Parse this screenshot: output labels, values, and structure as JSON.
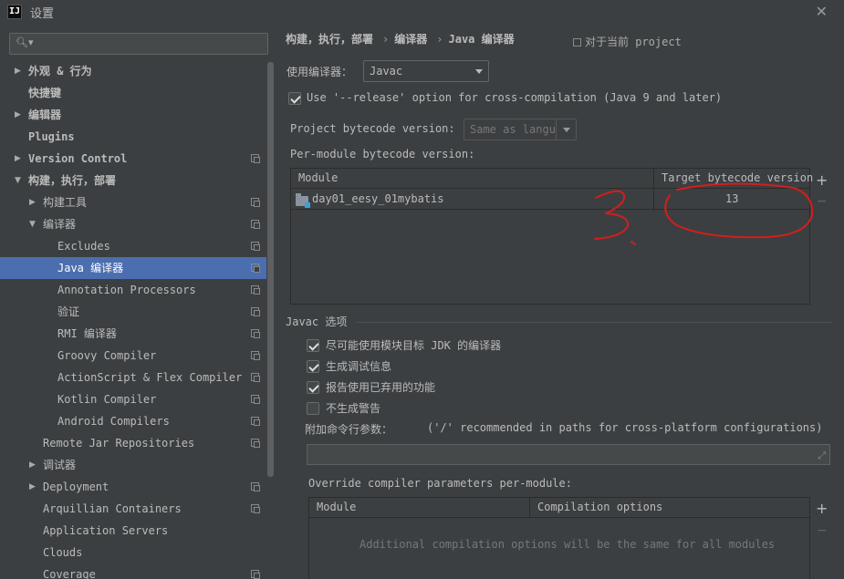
{
  "window": {
    "title": "设置",
    "app_icon": "intellij-icon",
    "close_icon": "close-icon"
  },
  "search": {
    "placeholder": "",
    "icon": "search-icon"
  },
  "tree": [
    {
      "label": "外观 & 行为",
      "level": 0,
      "arrow": "right",
      "copy": false,
      "selected": false,
      "bold": true
    },
    {
      "label": "快捷键",
      "level": 0,
      "arrow": "none",
      "copy": false,
      "selected": false,
      "bold": true
    },
    {
      "label": "编辑器",
      "level": 0,
      "arrow": "right",
      "copy": false,
      "selected": false,
      "bold": true
    },
    {
      "label": "Plugins",
      "level": 0,
      "arrow": "none",
      "copy": false,
      "selected": false,
      "bold": true
    },
    {
      "label": "Version Control",
      "level": 0,
      "arrow": "right",
      "copy": true,
      "selected": false,
      "bold": true
    },
    {
      "label": "构建，执行，部署",
      "level": 0,
      "arrow": "down",
      "copy": false,
      "selected": false,
      "bold": true
    },
    {
      "label": "构建工具",
      "level": 1,
      "arrow": "right",
      "copy": true,
      "selected": false,
      "bold": false
    },
    {
      "label": "编译器",
      "level": 1,
      "arrow": "down",
      "copy": true,
      "selected": false,
      "bold": false
    },
    {
      "label": "Excludes",
      "level": 2,
      "arrow": "none",
      "copy": true,
      "selected": false,
      "bold": false
    },
    {
      "label": "Java 编译器",
      "level": 2,
      "arrow": "none",
      "copy": true,
      "selected": true,
      "bold": false
    },
    {
      "label": "Annotation Processors",
      "level": 2,
      "arrow": "none",
      "copy": true,
      "selected": false,
      "bold": false
    },
    {
      "label": "验证",
      "level": 2,
      "arrow": "none",
      "copy": true,
      "selected": false,
      "bold": false
    },
    {
      "label": "RMI 编译器",
      "level": 2,
      "arrow": "none",
      "copy": true,
      "selected": false,
      "bold": false
    },
    {
      "label": "Groovy Compiler",
      "level": 2,
      "arrow": "none",
      "copy": true,
      "selected": false,
      "bold": false
    },
    {
      "label": "ActionScript & Flex Compiler",
      "level": 2,
      "arrow": "none",
      "copy": true,
      "selected": false,
      "bold": false
    },
    {
      "label": "Kotlin Compiler",
      "level": 2,
      "arrow": "none",
      "copy": true,
      "selected": false,
      "bold": false
    },
    {
      "label": "Android Compilers",
      "level": 2,
      "arrow": "none",
      "copy": true,
      "selected": false,
      "bold": false
    },
    {
      "label": "Remote Jar Repositories",
      "level": 1,
      "arrow": "none",
      "copy": true,
      "selected": false,
      "bold": false
    },
    {
      "label": "调试器",
      "level": 1,
      "arrow": "right",
      "copy": false,
      "selected": false,
      "bold": false
    },
    {
      "label": "Deployment",
      "level": 1,
      "arrow": "right",
      "copy": true,
      "selected": false,
      "bold": false
    },
    {
      "label": "Arquillian Containers",
      "level": 1,
      "arrow": "none",
      "copy": true,
      "selected": false,
      "bold": false
    },
    {
      "label": "Application Servers",
      "level": 1,
      "arrow": "none",
      "copy": false,
      "selected": false,
      "bold": false
    },
    {
      "label": "Clouds",
      "level": 1,
      "arrow": "none",
      "copy": false,
      "selected": false,
      "bold": false
    },
    {
      "label": "Coverage",
      "level": 1,
      "arrow": "none",
      "copy": true,
      "selected": false,
      "bold": false
    }
  ],
  "breadcrumb": {
    "part1": "构建，执行，部署",
    "sep1": "›",
    "part2": "编译器",
    "sep2": "›",
    "part3": "Java 编译器"
  },
  "for_project": "对于当前 project",
  "compiler": {
    "label": "使用编译器：",
    "value": "Javac"
  },
  "release_option": {
    "checked": true,
    "label": "Use '--release' option for cross-compilation (Java 9 and later)"
  },
  "project_bytecode": {
    "label": "Project bytecode version:",
    "value": "Same as langu"
  },
  "per_module": {
    "label": "Per-module bytecode version:",
    "headers": [
      "Module",
      "Target bytecode version"
    ],
    "rows": [
      {
        "module": "day01_eesy_01mybatis",
        "version": "13"
      }
    ]
  },
  "javac": {
    "section_title": "Javac 选项",
    "options": [
      {
        "label": "尽可能使用模块目标 JDK 的编译器",
        "checked": true
      },
      {
        "label": "生成调试信息",
        "checked": true
      },
      {
        "label": "报告使用已弃用的功能",
        "checked": true
      },
      {
        "label": "不生成警告",
        "checked": false
      }
    ],
    "cmd_label": "附加命令行参数：",
    "cmd_hint": "('/' recommended in paths for cross-platform configurations)",
    "cmd_value": ""
  },
  "override": {
    "label": "Override compiler parameters per-module:",
    "headers": [
      "Module",
      "Compilation options"
    ],
    "empty": "Additional compilation options will be the same for all modules"
  },
  "annotation": {
    "text": "3.",
    "color": "#d21e1e"
  }
}
